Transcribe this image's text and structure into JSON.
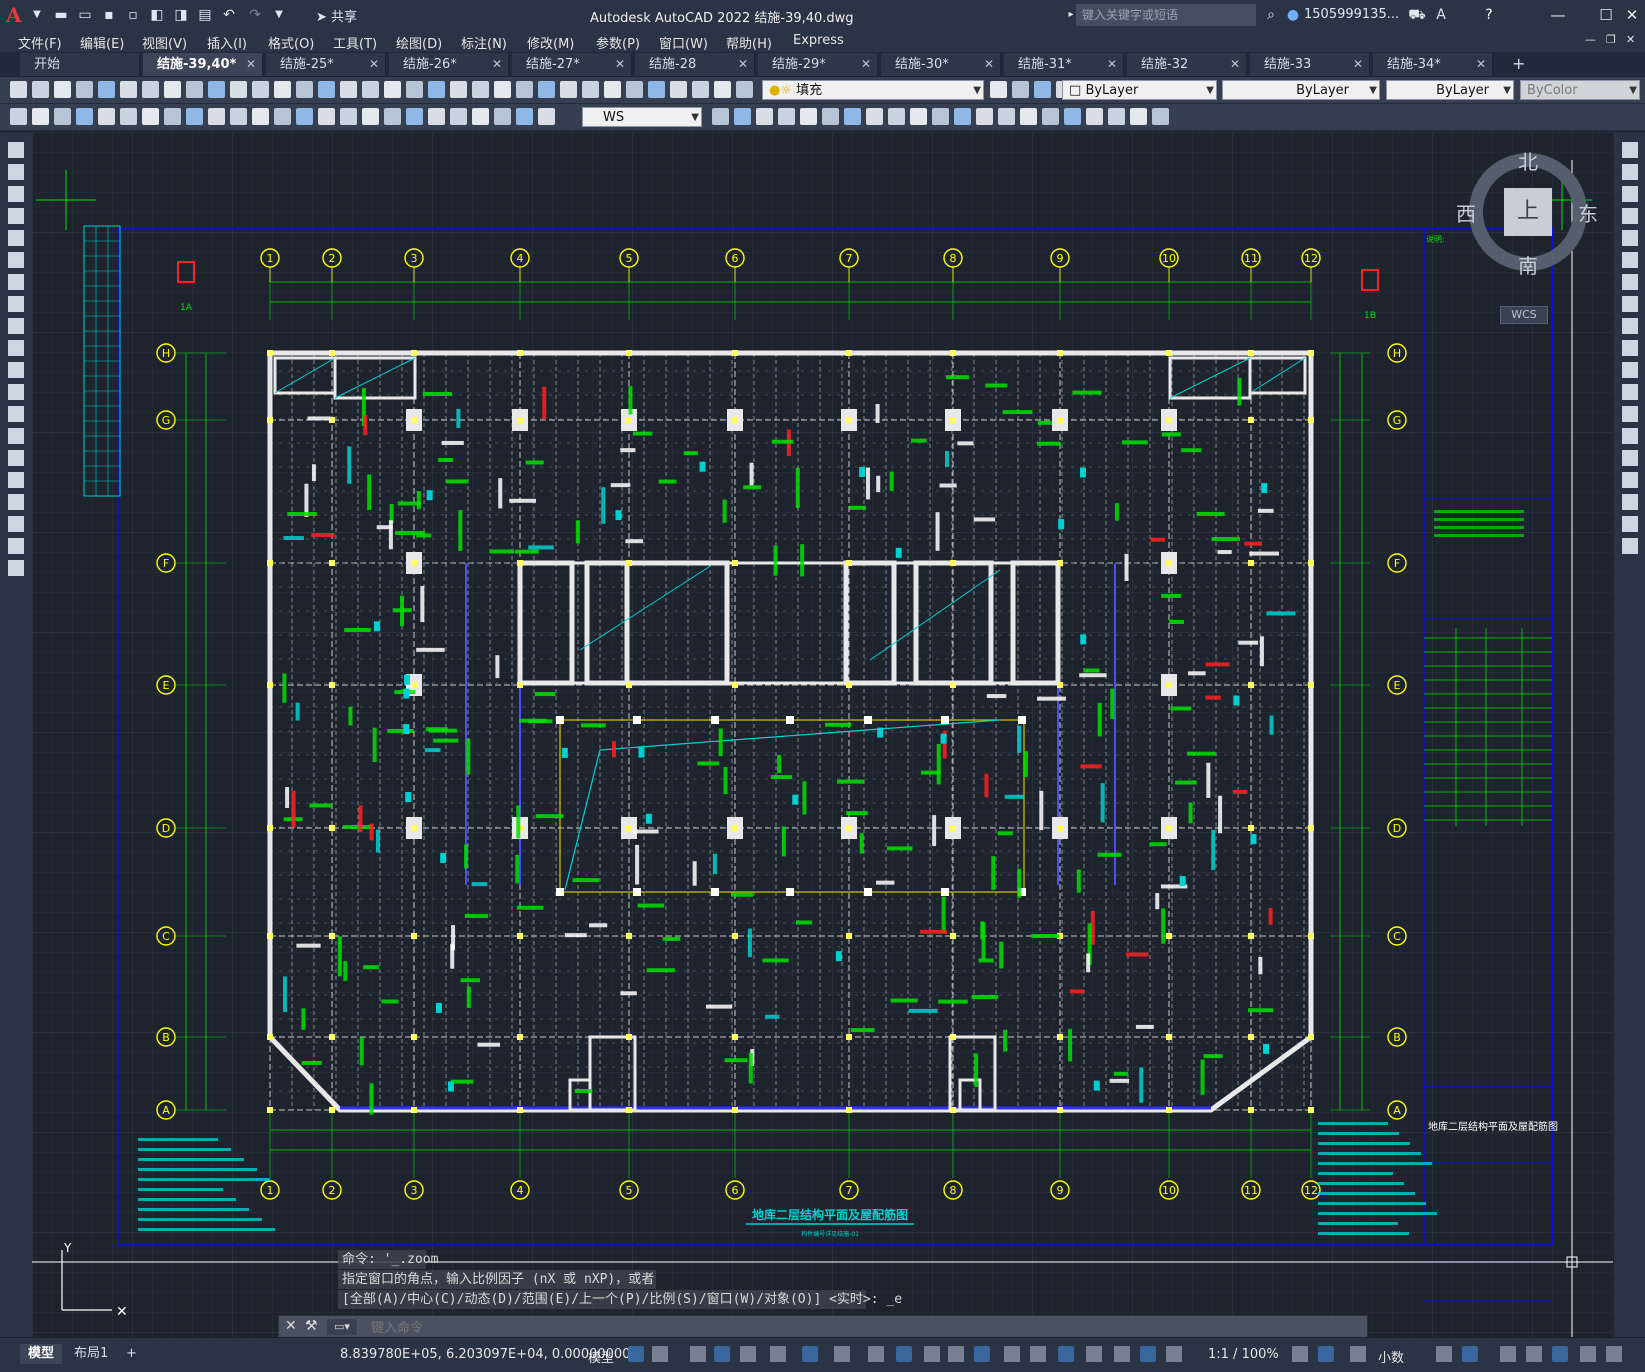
{
  "app": {
    "title": "Autodesk AutoCAD 2022    结施-39,40.dwg",
    "logo": "A",
    "share_label": "共享",
    "search_placeholder": "键入关键字或短语",
    "user": "1505999135...",
    "min_icon": "—",
    "max_icon": "☐",
    "close_icon": "✕"
  },
  "menu": [
    "文件(F)",
    "编辑(E)",
    "视图(V)",
    "插入(I)",
    "格式(O)",
    "工具(T)",
    "绘图(D)",
    "标注(N)",
    "修改(M)",
    "参数(P)",
    "窗口(W)",
    "帮助(H)",
    "Express"
  ],
  "tabs": [
    {
      "label": "开始",
      "active": false,
      "close": false
    },
    {
      "label": "结施-39,40*",
      "active": true,
      "close": true
    },
    {
      "label": "结施-25*",
      "active": false,
      "close": true
    },
    {
      "label": "结施-26*",
      "active": false,
      "close": true
    },
    {
      "label": "结施-27*",
      "active": false,
      "close": true
    },
    {
      "label": "结施-28",
      "active": false,
      "close": true
    },
    {
      "label": "结施-29*",
      "active": false,
      "close": true
    },
    {
      "label": "结施-30*",
      "active": false,
      "close": true
    },
    {
      "label": "结施-31*",
      "active": false,
      "close": true
    },
    {
      "label": "结施-32",
      "active": false,
      "close": true
    },
    {
      "label": "结施-33",
      "active": false,
      "close": true
    },
    {
      "label": "结施-34*",
      "active": false,
      "close": true
    }
  ],
  "toolbar": {
    "layer_value": "填充",
    "color_value": "ByLayer",
    "linetype_value": "ByLayer",
    "lineweight_value": "ByLayer",
    "plotstyle_value": "ByColor",
    "ucs_value": "WS"
  },
  "viewcube": {
    "north": "北",
    "south": "南",
    "west": "西",
    "east": "东",
    "top": "上",
    "wcs": "WCS"
  },
  "drawing": {
    "title": "地库二层结构平面及屋配筋图",
    "subtitle": "构件编号详见结施-01",
    "col_axes": [
      "1",
      "2",
      "3",
      "4",
      "5",
      "6",
      "7",
      "8",
      "9",
      "10",
      "11",
      "12"
    ],
    "row_axes": [
      "H",
      "G",
      "F",
      "E",
      "D",
      "C",
      "B",
      "A"
    ],
    "section_marks": [
      "1A",
      "1B"
    ],
    "notes_title": "说明:",
    "titleblock_name": "地库二层结构平面及屋配筋图"
  },
  "command": {
    "history": [
      "命令: '_.zoom",
      "指定窗口的角点，输入比例因子 (nX 或 nXP)，或者",
      "[全部(A)/中心(C)/动态(D)/范围(E)/上一个(P)/比例(S)/窗口(W)/对象(O)] <实时>: _e"
    ],
    "placeholder": "键入命令"
  },
  "status": {
    "model_tab": "模型",
    "layout_tab": "布局1",
    "add_tab": "+",
    "coords": "8.839780E+05, 6.203097E+04, 0.00000000",
    "model_label": "模型",
    "scale": "1:1 / 100%",
    "units": "小数"
  },
  "colors": {
    "cad_bg": "#1e242d",
    "frame": "#1010c8",
    "beam": "#ffffff",
    "dim": "#00e000",
    "axis": "#ffff00",
    "accent": "#00d0d0",
    "red": "#ff2020"
  }
}
